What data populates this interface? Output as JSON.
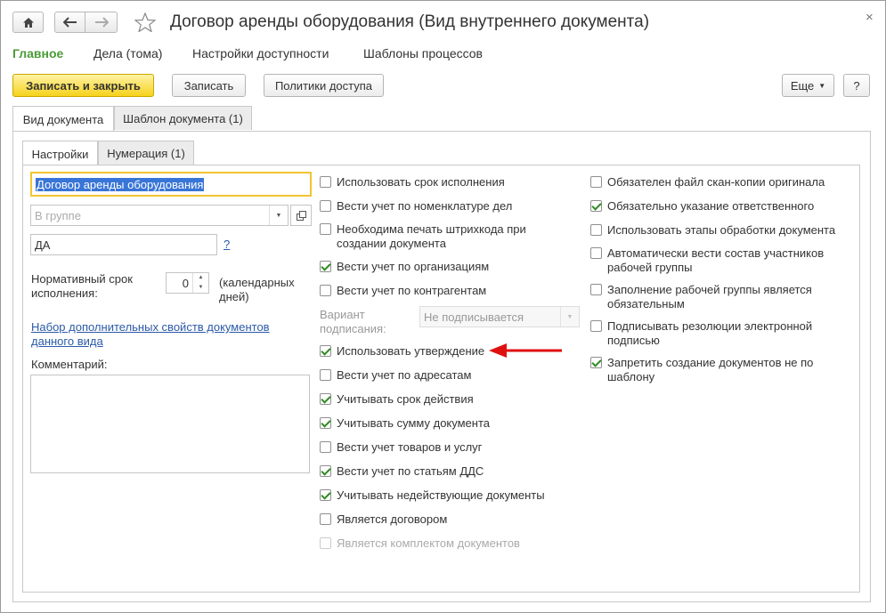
{
  "window": {
    "title": "Договор аренды оборудования (Вид внутреннего документа)",
    "close_glyph": "×"
  },
  "nav": {
    "home_icon": "home-icon",
    "back_icon": "back-arrow-icon",
    "forward_icon": "forward-arrow-icon",
    "favorite_icon": "star-icon"
  },
  "menu": [
    "Главное",
    "Дела (тома)",
    "Настройки доступности",
    "Шаблоны процессов"
  ],
  "toolbar": {
    "save_close": "Записать и закрыть",
    "save": "Записать",
    "access_policies": "Политики доступа",
    "more": "Еще",
    "help": "?"
  },
  "tabs_outer": [
    "Вид документа",
    "Шаблон документа (1)"
  ],
  "tabs_inner": [
    "Настройки",
    "Нумерация (1)"
  ],
  "form": {
    "name_value": "Договор аренды оборудования",
    "group_placeholder": "В группе",
    "code_value": "ДА",
    "code_help": "?",
    "deadline_label": "Нормативный срок исполнения:",
    "deadline_value": "0",
    "deadline_unit": "(календарных дней)",
    "props_link": "Набор дополнительных свойств документов данного вида",
    "comment_label": "Комментарий:"
  },
  "middle_checks": [
    {
      "label": "Использовать срок исполнения",
      "checked": false
    },
    {
      "label": "Вести учет по номенклатуре дел",
      "checked": false
    },
    {
      "label": "Необходима печать штрихкода при создании документа",
      "checked": false
    },
    {
      "label": "Вести учет по организациям",
      "checked": true
    },
    {
      "label": "Вести учет по контрагентам",
      "checked": false
    }
  ],
  "signing": {
    "label": "Вариант подписания:",
    "value": "Не подписывается"
  },
  "middle_checks2": [
    {
      "label": "Использовать утверждение",
      "checked": true
    },
    {
      "label": "Вести учет по адресатам",
      "checked": false
    },
    {
      "label": "Учитывать срок действия",
      "checked": true
    },
    {
      "label": "Учитывать сумму документа",
      "checked": true
    },
    {
      "label": "Вести учет товаров и услуг",
      "checked": false
    },
    {
      "label": "Вести учет по статьям ДДС",
      "checked": true
    },
    {
      "label": "Учитывать недействующие документы",
      "checked": true
    },
    {
      "label": "Является договором",
      "checked": false
    },
    {
      "label": "Является комплектом документов",
      "checked": false,
      "disabled": true
    }
  ],
  "right_checks": [
    {
      "label": "Обязателен файл скан-копии оригинала",
      "checked": false
    },
    {
      "label": "Обязательно указание ответственного",
      "checked": true
    },
    {
      "label": "Использовать этапы обработки документа",
      "checked": false
    },
    {
      "label": "Автоматически вести состав участников рабочей группы",
      "checked": false
    },
    {
      "label": "Заполнение рабочей группы является обязательным",
      "checked": false
    },
    {
      "label": "Подписывать резолюции электронной подписью",
      "checked": false
    },
    {
      "label": "Запретить создание документов не по шаблону",
      "checked": true
    }
  ],
  "colors": {
    "accent_green": "#4b9b37",
    "primary_button": "#f6d21c",
    "annotation_arrow": "#e01010"
  }
}
